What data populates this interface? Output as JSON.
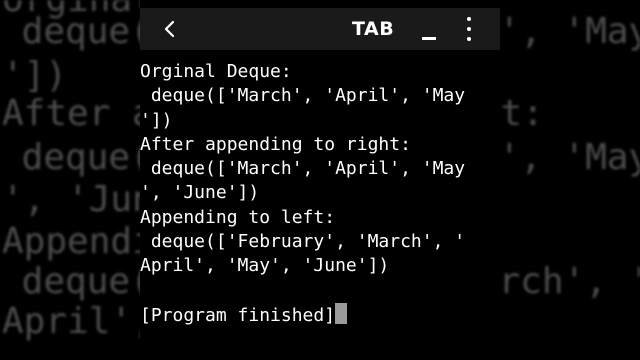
{
  "toolbar": {
    "back_icon": "chevron-left-icon",
    "tab_label": "TAB",
    "minimize_icon": "minimize-icon",
    "more_icon": "more-vert-icon"
  },
  "terminal": {
    "lines": [
      "Orginal Deque:",
      " deque(['March', 'April', 'May",
      "'])",
      "After appending to right:",
      " deque(['March', 'April', 'May",
      "', 'June'])",
      "Appending to left:",
      " deque(['February', 'March', '",
      "April', 'May', 'June'])",
      "",
      "[Program finished]"
    ]
  },
  "background": {
    "lines": [
      "orginal Deque:",
      " deque(['March', 'April', 'May",
      "'])",
      "After appending to right:",
      " deque(['March', 'April', 'May",
      "', 'June'])",
      "Appending to left:",
      " deque(['February', 'March', '",
      "April', 'May', 'June'])"
    ]
  },
  "colors": {
    "toolbar_bg": "#1a1a1a",
    "terminal_text": "#ffffff",
    "cursor": "#9a9a9a"
  }
}
